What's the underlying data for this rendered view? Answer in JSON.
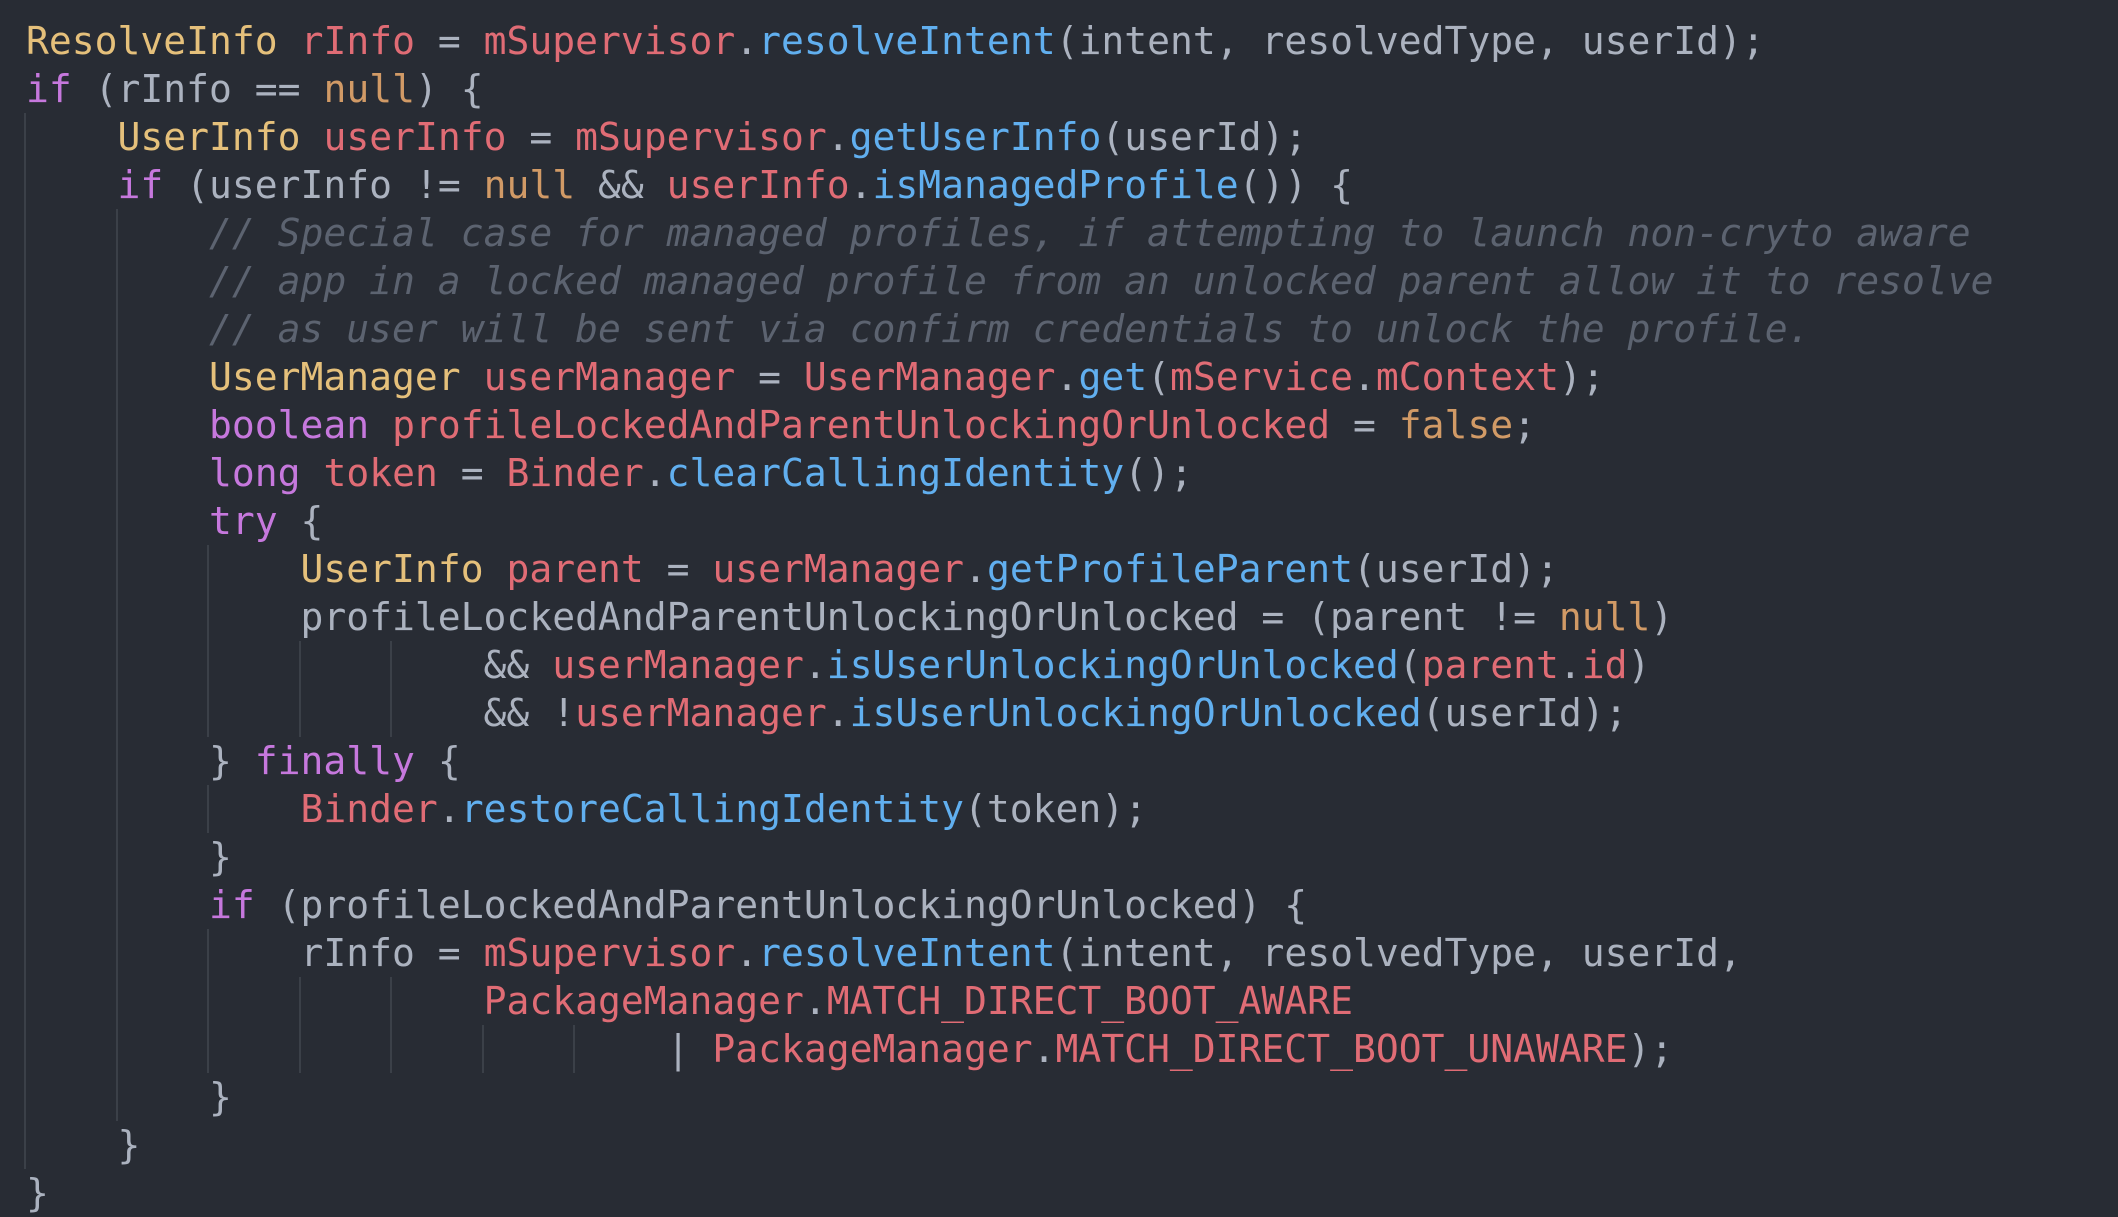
{
  "editor": {
    "theme_colors": {
      "background": "#282c34",
      "keyword": "#c678dd",
      "type": "#e5c07b",
      "variable": "#e06c75",
      "function": "#61afef",
      "literal": "#d19a66",
      "comment": "#5c6370",
      "plain": "#abb2bf",
      "indent_guide": "#3b4048"
    },
    "lines": [
      {
        "guides": [],
        "tokens": [
          [
            "typ",
            "ResolveInfo"
          ],
          [
            "pl",
            " "
          ],
          [
            "var",
            "rInfo"
          ],
          [
            "pl",
            " = "
          ],
          [
            "var",
            "mSupervisor"
          ],
          [
            "pl",
            "."
          ],
          [
            "fn",
            "resolveIntent"
          ],
          [
            "pl",
            "(intent, resolvedType, userId);"
          ]
        ]
      },
      {
        "guides": [],
        "tokens": [
          [
            "kw",
            "if"
          ],
          [
            "pl",
            " (rInfo == "
          ],
          [
            "lit",
            "null"
          ],
          [
            "pl",
            ") {"
          ]
        ]
      },
      {
        "guides": [
          0
        ],
        "tokens": [
          [
            "pl",
            "    "
          ],
          [
            "typ",
            "UserInfo"
          ],
          [
            "pl",
            " "
          ],
          [
            "var",
            "userInfo"
          ],
          [
            "pl",
            " = "
          ],
          [
            "var",
            "mSupervisor"
          ],
          [
            "pl",
            "."
          ],
          [
            "fn",
            "getUserInfo"
          ],
          [
            "pl",
            "(userId);"
          ]
        ]
      },
      {
        "guides": [
          0
        ],
        "tokens": [
          [
            "pl",
            "    "
          ],
          [
            "kw",
            "if"
          ],
          [
            "pl",
            " (userInfo != "
          ],
          [
            "lit",
            "null"
          ],
          [
            "pl",
            " && "
          ],
          [
            "var",
            "userInfo"
          ],
          [
            "pl",
            "."
          ],
          [
            "fn",
            "isManagedProfile"
          ],
          [
            "pl",
            "()) {"
          ]
        ]
      },
      {
        "guides": [
          0,
          4
        ],
        "tokens": [
          [
            "pl",
            "        "
          ],
          [
            "cmt",
            "// Special case for managed profiles, if attempting to launch non-cryto aware"
          ]
        ]
      },
      {
        "guides": [
          0,
          4
        ],
        "tokens": [
          [
            "pl",
            "        "
          ],
          [
            "cmt",
            "// app in a locked managed profile from an unlocked parent allow it to resolve"
          ]
        ]
      },
      {
        "guides": [
          0,
          4
        ],
        "tokens": [
          [
            "pl",
            "        "
          ],
          [
            "cmt",
            "// as user will be sent via confirm credentials to unlock the profile."
          ]
        ]
      },
      {
        "guides": [
          0,
          4
        ],
        "tokens": [
          [
            "pl",
            "        "
          ],
          [
            "typ",
            "UserManager"
          ],
          [
            "pl",
            " "
          ],
          [
            "var",
            "userManager"
          ],
          [
            "pl",
            " = "
          ],
          [
            "var",
            "UserManager"
          ],
          [
            "pl",
            "."
          ],
          [
            "fn",
            "get"
          ],
          [
            "pl",
            "("
          ],
          [
            "var",
            "mService"
          ],
          [
            "pl",
            "."
          ],
          [
            "var",
            "mContext"
          ],
          [
            "pl",
            ");"
          ]
        ]
      },
      {
        "guides": [
          0,
          4
        ],
        "tokens": [
          [
            "pl",
            "        "
          ],
          [
            "kw",
            "boolean"
          ],
          [
            "pl",
            " "
          ],
          [
            "var",
            "profileLockedAndParentUnlockingOrUnlocked"
          ],
          [
            "pl",
            " = "
          ],
          [
            "lit",
            "false"
          ],
          [
            "pl",
            ";"
          ]
        ]
      },
      {
        "guides": [
          0,
          4
        ],
        "tokens": [
          [
            "pl",
            "        "
          ],
          [
            "kw",
            "long"
          ],
          [
            "pl",
            " "
          ],
          [
            "var",
            "token"
          ],
          [
            "pl",
            " = "
          ],
          [
            "var",
            "Binder"
          ],
          [
            "pl",
            "."
          ],
          [
            "fn",
            "clearCallingIdentity"
          ],
          [
            "pl",
            "();"
          ]
        ]
      },
      {
        "guides": [
          0,
          4
        ],
        "tokens": [
          [
            "pl",
            "        "
          ],
          [
            "kw",
            "try"
          ],
          [
            "pl",
            " {"
          ]
        ]
      },
      {
        "guides": [
          0,
          4,
          8
        ],
        "tokens": [
          [
            "pl",
            "            "
          ],
          [
            "typ",
            "UserInfo"
          ],
          [
            "pl",
            " "
          ],
          [
            "var",
            "parent"
          ],
          [
            "pl",
            " = "
          ],
          [
            "var",
            "userManager"
          ],
          [
            "pl",
            "."
          ],
          [
            "fn",
            "getProfileParent"
          ],
          [
            "pl",
            "(userId);"
          ]
        ]
      },
      {
        "guides": [
          0,
          4,
          8
        ],
        "tokens": [
          [
            "pl",
            "            profileLockedAndParentUnlockingOrUnlocked = (parent != "
          ],
          [
            "lit",
            "null"
          ],
          [
            "pl",
            ")"
          ]
        ]
      },
      {
        "guides": [
          0,
          4,
          8,
          12,
          16
        ],
        "tokens": [
          [
            "pl",
            "                    && "
          ],
          [
            "var",
            "userManager"
          ],
          [
            "pl",
            "."
          ],
          [
            "fn",
            "isUserUnlockingOrUnlocked"
          ],
          [
            "pl",
            "("
          ],
          [
            "var",
            "parent"
          ],
          [
            "pl",
            "."
          ],
          [
            "var",
            "id"
          ],
          [
            "pl",
            ")"
          ]
        ]
      },
      {
        "guides": [
          0,
          4,
          8,
          12,
          16
        ],
        "tokens": [
          [
            "pl",
            "                    && !"
          ],
          [
            "var",
            "userManager"
          ],
          [
            "pl",
            "."
          ],
          [
            "fn",
            "isUserUnlockingOrUnlocked"
          ],
          [
            "pl",
            "(userId);"
          ]
        ]
      },
      {
        "guides": [
          0,
          4
        ],
        "tokens": [
          [
            "pl",
            "        } "
          ],
          [
            "kw",
            "finally"
          ],
          [
            "pl",
            " {"
          ]
        ]
      },
      {
        "guides": [
          0,
          4,
          8
        ],
        "tokens": [
          [
            "pl",
            "            "
          ],
          [
            "var",
            "Binder"
          ],
          [
            "pl",
            "."
          ],
          [
            "fn",
            "restoreCallingIdentity"
          ],
          [
            "pl",
            "(token);"
          ]
        ]
      },
      {
        "guides": [
          0,
          4
        ],
        "tokens": [
          [
            "pl",
            "        }"
          ]
        ]
      },
      {
        "guides": [
          0,
          4
        ],
        "tokens": [
          [
            "pl",
            "        "
          ],
          [
            "kw",
            "if"
          ],
          [
            "pl",
            " (profileLockedAndParentUnlockingOrUnlocked) {"
          ]
        ]
      },
      {
        "guides": [
          0,
          4,
          8
        ],
        "tokens": [
          [
            "pl",
            "            rInfo = "
          ],
          [
            "var",
            "mSupervisor"
          ],
          [
            "pl",
            "."
          ],
          [
            "fn",
            "resolveIntent"
          ],
          [
            "pl",
            "(intent, resolvedType, userId,"
          ]
        ]
      },
      {
        "guides": [
          0,
          4,
          8,
          12,
          16
        ],
        "tokens": [
          [
            "pl",
            "                    "
          ],
          [
            "var",
            "PackageManager"
          ],
          [
            "pl",
            "."
          ],
          [
            "var",
            "MATCH_DIRECT_BOOT_AWARE"
          ]
        ]
      },
      {
        "guides": [
          0,
          4,
          8,
          12,
          16,
          20,
          24
        ],
        "tokens": [
          [
            "pl",
            "                            | "
          ],
          [
            "var",
            "PackageManager"
          ],
          [
            "pl",
            "."
          ],
          [
            "var",
            "MATCH_DIRECT_BOOT_UNAWARE"
          ],
          [
            "pl",
            ");"
          ]
        ]
      },
      {
        "guides": [
          0,
          4
        ],
        "tokens": [
          [
            "pl",
            "        }"
          ]
        ]
      },
      {
        "guides": [
          0
        ],
        "tokens": [
          [
            "pl",
            "    }"
          ]
        ]
      },
      {
        "guides": [],
        "tokens": [
          [
            "pl",
            "}"
          ]
        ]
      }
    ]
  }
}
